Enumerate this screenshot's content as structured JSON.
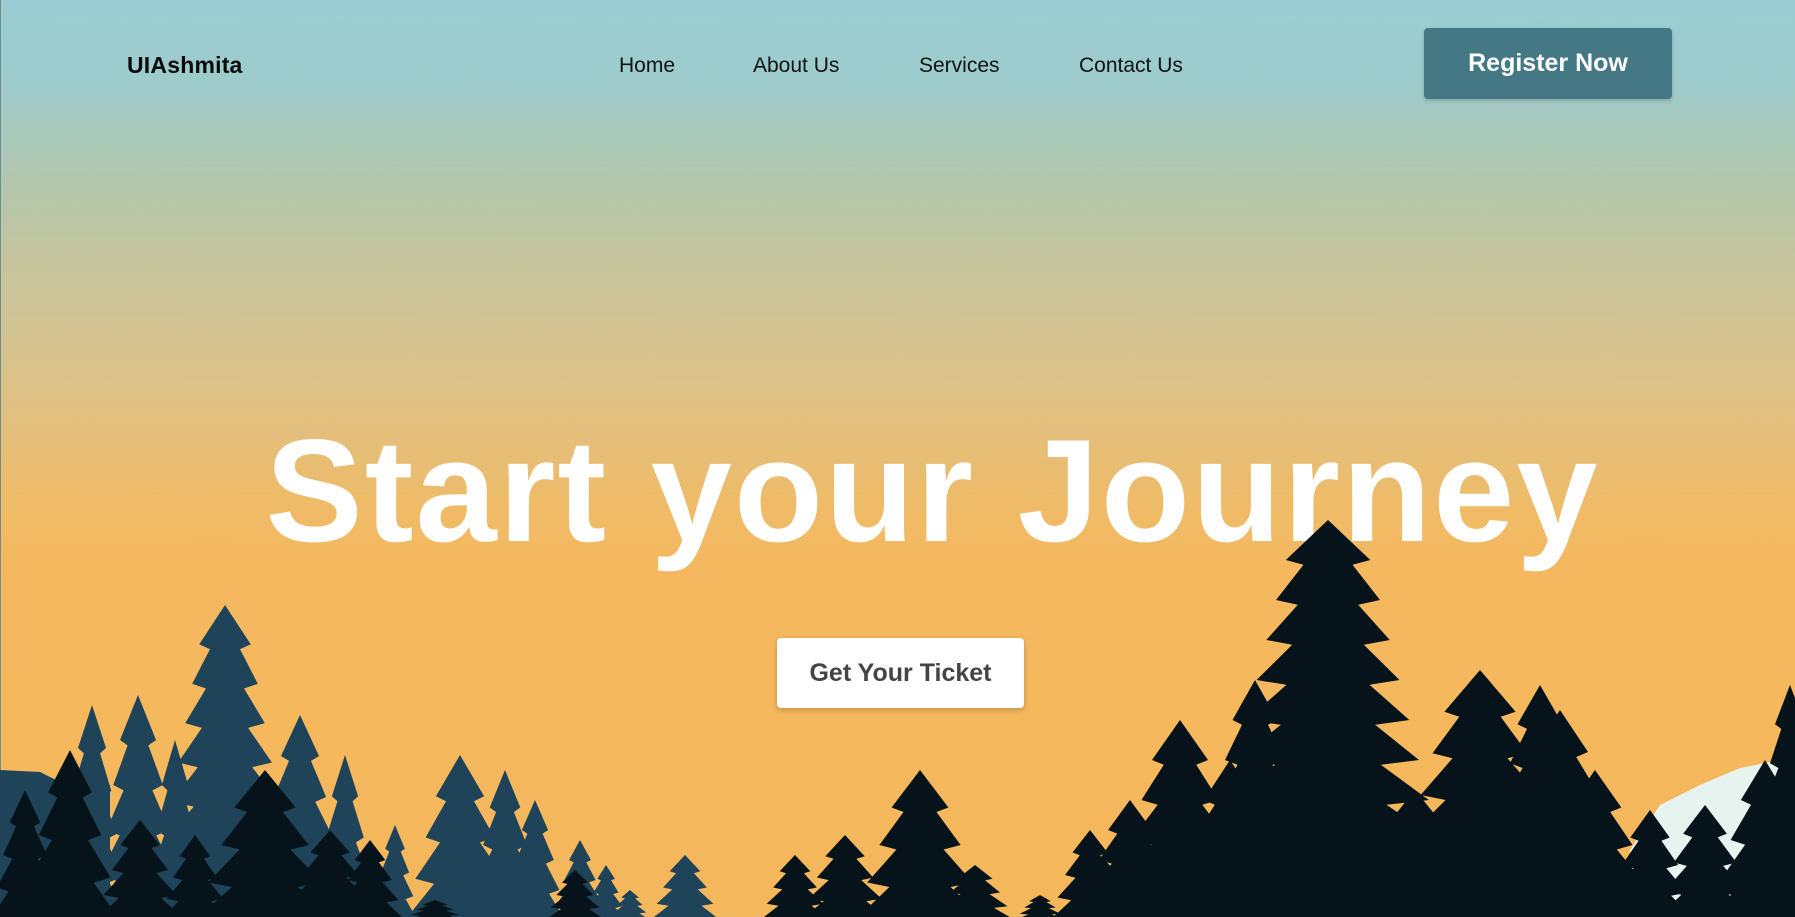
{
  "brand": {
    "logo_text": "UIAshmita"
  },
  "nav": {
    "items": [
      {
        "label": "Home"
      },
      {
        "label": "About Us"
      },
      {
        "label": "Services"
      },
      {
        "label": "Contact Us"
      }
    ],
    "cta_label": "Register Now"
  },
  "hero": {
    "title": "Start your Journey",
    "cta_label": "Get Your Ticket"
  },
  "colors": {
    "sky_top": "#9acdd2",
    "sky_bottom": "#f5b75c",
    "register_button": "#437884",
    "trees_back": "#1f4459",
    "trees_front": "#06131a",
    "snow": "#e6f3ef"
  }
}
